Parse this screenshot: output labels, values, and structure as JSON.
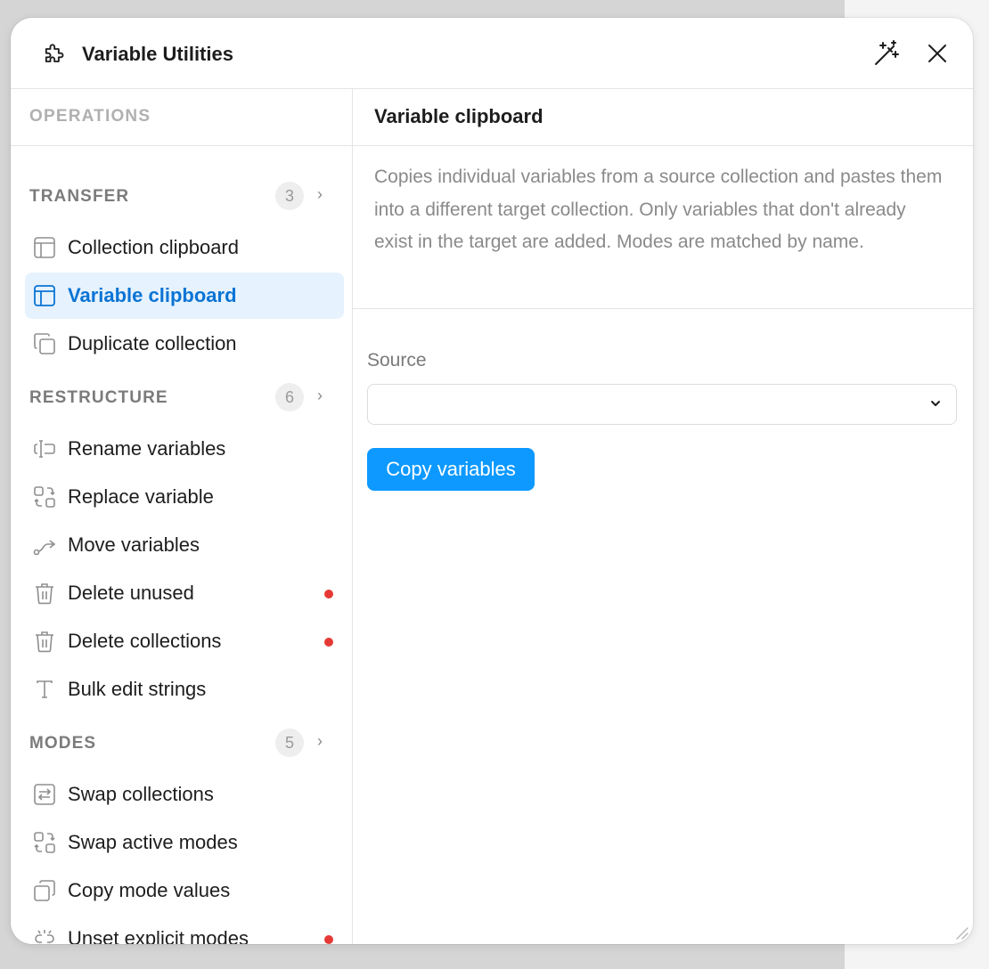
{
  "window": {
    "title": "Variable Utilities",
    "icons": {
      "app": "puzzle-icon",
      "wand": "magic-wand-icon",
      "close": "close-icon"
    }
  },
  "sidebar": {
    "header": "OPERATIONS",
    "sections": [
      {
        "label": "TRANSFER",
        "count": "3",
        "items": [
          {
            "label": "Collection clipboard",
            "icon": "table-icon",
            "active": false,
            "alert": false
          },
          {
            "label": "Variable clipboard",
            "icon": "table-icon",
            "active": true,
            "alert": false
          },
          {
            "label": "Duplicate collection",
            "icon": "copy-icon",
            "active": false,
            "alert": false
          }
        ]
      },
      {
        "label": "RESTRUCTURE",
        "count": "6",
        "items": [
          {
            "label": "Rename variables",
            "icon": "text-cursor-icon",
            "active": false,
            "alert": false
          },
          {
            "label": "Replace variable",
            "icon": "replace-icon",
            "active": false,
            "alert": false
          },
          {
            "label": "Move variables",
            "icon": "move-path-icon",
            "active": false,
            "alert": false
          },
          {
            "label": "Delete unused",
            "icon": "trash-icon",
            "active": false,
            "alert": true
          },
          {
            "label": "Delete collections",
            "icon": "trash-icon",
            "active": false,
            "alert": true
          },
          {
            "label": "Bulk edit strings",
            "icon": "type-icon",
            "active": false,
            "alert": false
          }
        ]
      },
      {
        "label": "MODES",
        "count": "5",
        "items": [
          {
            "label": "Swap collections",
            "icon": "swap-arrows-icon",
            "active": false,
            "alert": false
          },
          {
            "label": "Swap active modes",
            "icon": "replace-icon",
            "active": false,
            "alert": false
          },
          {
            "label": "Copy mode values",
            "icon": "copy-icon",
            "active": false,
            "alert": false
          },
          {
            "label": "Unset explicit modes",
            "icon": "unlink-icon",
            "active": false,
            "alert": true
          }
        ]
      }
    ]
  },
  "main": {
    "title": "Variable clipboard",
    "description": "Copies individual variables from a source collection and pastes them into a different target collection. Only variables that don't already exist in the target are added. Modes are matched by name.",
    "source_label": "Source",
    "source_value": "",
    "copy_button": "Copy variables"
  },
  "colors": {
    "accent": "#0d99ff",
    "active_text": "#0a74d4",
    "active_bg": "#e6f2fe",
    "alert_dot": "#e53935"
  }
}
